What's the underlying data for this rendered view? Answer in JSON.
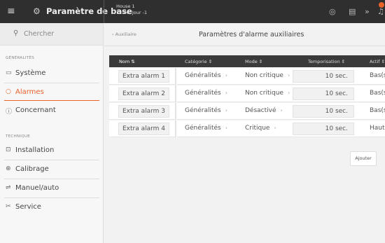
{
  "topbar": {
    "app_title": "Paramètre de base",
    "house_name": "House 1",
    "house_time": "12:46, Jour -1"
  },
  "sidebar": {
    "search_placeholder": "Chercher",
    "section_general": "GÉNÉRALITÉS",
    "section_technique": "TECHNIQUE",
    "items": [
      {
        "label": "Système",
        "icon": "system-icon"
      },
      {
        "label": "Alarmes",
        "icon": "alarm-icon"
      },
      {
        "label": "Concernant",
        "icon": "info-icon"
      },
      {
        "label": "Installation",
        "icon": "installation-icon"
      },
      {
        "label": "Calibrage",
        "icon": "calibration-icon"
      },
      {
        "label": "Manuel/auto",
        "icon": "manual-auto-icon"
      },
      {
        "label": "Service",
        "icon": "service-icon"
      }
    ],
    "accent_color": "#e8622a"
  },
  "main": {
    "back_label": "Auxiliaire",
    "title": "Paramètres d'alarme auxiliaires",
    "columns": [
      "Nom",
      "Catégorie",
      "Mode",
      "Temporisation",
      "Actif"
    ],
    "rows": [
      {
        "name": "Extra alarm 1",
        "category": "Généralités",
        "mode": "Non critique",
        "delay": "10 sec.",
        "active": "Bas(s"
      },
      {
        "name": "Extra alarm 2",
        "category": "Généralités",
        "mode": "Non critique",
        "delay": "10 sec.",
        "active": "Bas(s"
      },
      {
        "name": "Extra alarm 3",
        "category": "Généralités",
        "mode": "Désactivé",
        "delay": "10 sec.",
        "active": "Bas(s"
      },
      {
        "name": "Extra alarm 4",
        "category": "Généralités",
        "mode": "Critique",
        "delay": "10 sec.",
        "active": "Haut("
      }
    ],
    "add_button": "Ajouter"
  }
}
